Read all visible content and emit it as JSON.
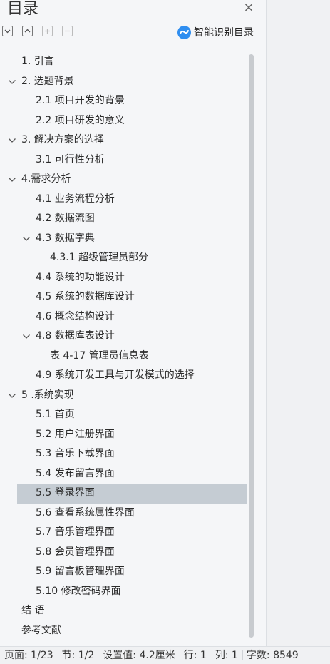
{
  "panel": {
    "title": "目录",
    "close_label": "×",
    "smart_label": "智能识别目录"
  },
  "toolbar": {
    "icons": [
      "collapse-all-icon",
      "expand-all-icon",
      "add-heading-icon",
      "remove-heading-icon"
    ]
  },
  "toc": [
    {
      "label": "1. 引言",
      "level": 1,
      "chevron": false
    },
    {
      "label": "2. 选题背景",
      "level": 1,
      "chevron": true
    },
    {
      "label": "2.1 项目开发的背景",
      "level": 2,
      "chevron": false
    },
    {
      "label": "2.2 项目研发的意义",
      "level": 2,
      "chevron": false
    },
    {
      "label": "3. 解决方案的选择",
      "level": 1,
      "chevron": true
    },
    {
      "label": "3.1 可行性分析",
      "level": 2,
      "chevron": false
    },
    {
      "label": "4.需求分析",
      "level": 1,
      "chevron": true
    },
    {
      "label": "4.1 业务流程分析",
      "level": 2,
      "chevron": false
    },
    {
      "label": "4.2 数据流图",
      "level": 2,
      "chevron": false
    },
    {
      "label": "4.3 数据字典",
      "level": 2,
      "chevron": true
    },
    {
      "label": "4.3.1 超级管理员部分",
      "level": 3,
      "chevron": false
    },
    {
      "label": "4.4 系统的功能设计",
      "level": 2,
      "chevron": false
    },
    {
      "label": "4.5 系统的数据库设计",
      "level": 2,
      "chevron": false
    },
    {
      "label": "4.6  概念结构设计",
      "level": 2,
      "chevron": false
    },
    {
      "label": "4.8 数据库表设计",
      "level": 2,
      "chevron": true
    },
    {
      "label": "表 4-17 管理员信息表",
      "level": 3,
      "chevron": false
    },
    {
      "label": "4.9  系统开发工具与开发模式的选择",
      "level": 2,
      "chevron": false
    },
    {
      "label": "5 .系统实现",
      "level": 1,
      "chevron": true
    },
    {
      "label": "5.1 首页",
      "level": 2,
      "chevron": false
    },
    {
      "label": "5.2  用户注册界面",
      "level": 2,
      "chevron": false
    },
    {
      "label": "5.3  音乐下载界面",
      "level": 2,
      "chevron": false
    },
    {
      "label": "5.4  发布留言界面",
      "level": 2,
      "chevron": false
    },
    {
      "label": "5.5  登录界面",
      "level": 2,
      "chevron": false,
      "selected": true
    },
    {
      "label": "5.6  查看系统属性界面",
      "level": 2,
      "chevron": false
    },
    {
      "label": "5.7  音乐管理界面",
      "level": 2,
      "chevron": false
    },
    {
      "label": "5.8 会员管理界面",
      "level": 2,
      "chevron": false
    },
    {
      "label": "5.9 留言板管理界面",
      "level": 2,
      "chevron": false
    },
    {
      "label": "5.10 修改密码界面",
      "level": 2,
      "chevron": false
    },
    {
      "label": "结  语",
      "level": 1,
      "chevron": false
    },
    {
      "label": "参考文献",
      "level": 1,
      "chevron": false
    }
  ],
  "status": {
    "page": "页面: 1/23",
    "section": "节: 1/2",
    "setting": "设置值: 4.2厘米",
    "line": "行: 1",
    "column": "列: 1",
    "word_count": "字数: 8549"
  }
}
